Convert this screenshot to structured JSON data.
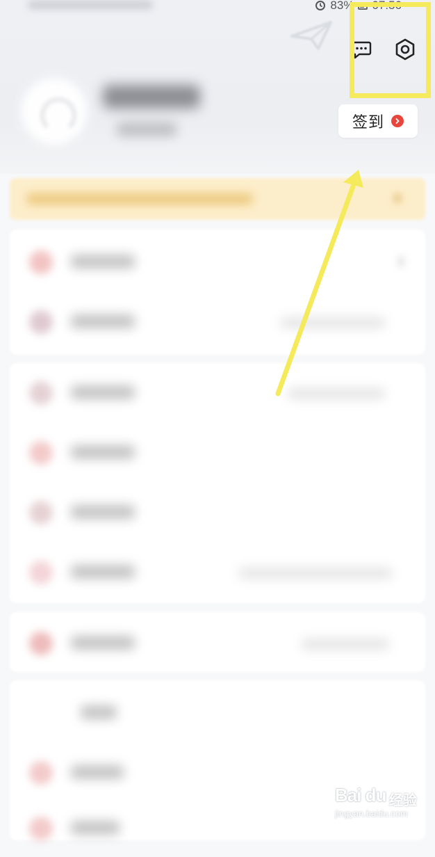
{
  "status_bar": {
    "battery_percent": "83%",
    "time": "07:56"
  },
  "header": {
    "checkin_label": "签到"
  },
  "icons": {
    "message": "chat-bubble-icon",
    "settings": "gear-icon",
    "checkin_badge": "chevron-right-icon"
  },
  "colors": {
    "highlight": "#f5e95c",
    "badge": "#e8453c",
    "banner": "#fdeecb"
  },
  "watermark": {
    "brand": "Bai du",
    "word": "经验",
    "url": "jingyan.baidu.com"
  }
}
